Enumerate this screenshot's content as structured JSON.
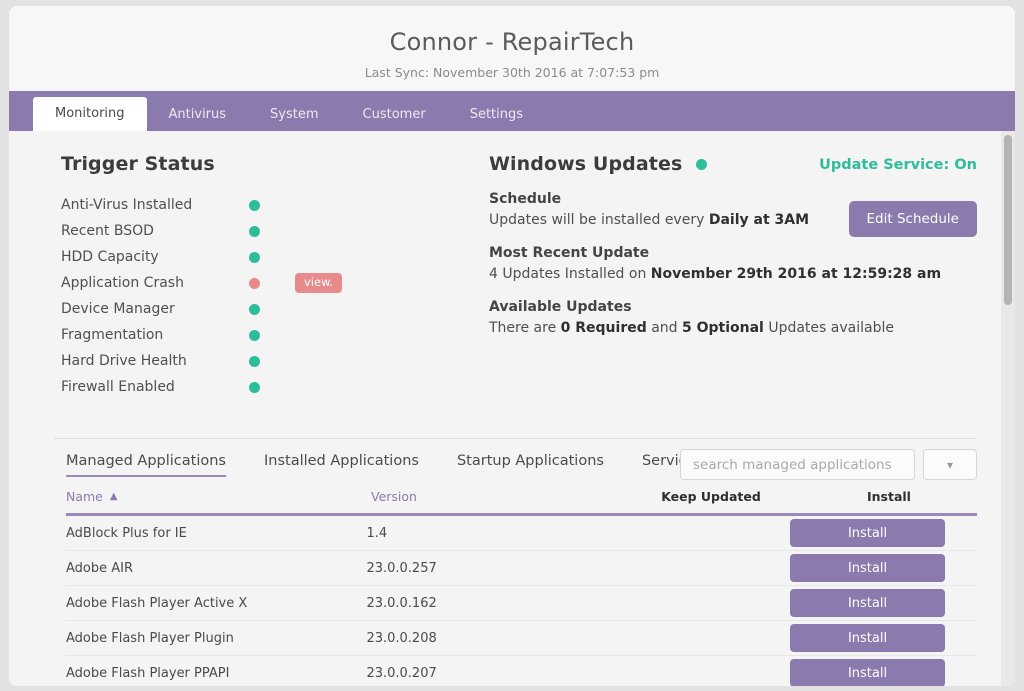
{
  "header": {
    "title": "Connor - RepairTech",
    "last_sync": "Last Sync: November 30th 2016 at 7:07:53 pm"
  },
  "nav": {
    "tabs": [
      {
        "label": "Monitoring",
        "active": true
      },
      {
        "label": "Antivirus",
        "active": false
      },
      {
        "label": "System",
        "active": false
      },
      {
        "label": "Customer",
        "active": false
      },
      {
        "label": "Settings",
        "active": false
      }
    ]
  },
  "trigger_status": {
    "title": "Trigger Status",
    "items": [
      {
        "label": "Anti-Virus Installed",
        "status": "green",
        "action": null
      },
      {
        "label": "Recent BSOD",
        "status": "green",
        "action": null
      },
      {
        "label": "HDD Capacity",
        "status": "green",
        "action": null
      },
      {
        "label": "Application Crash",
        "status": "red",
        "action": "view."
      },
      {
        "label": "Device Manager",
        "status": "green",
        "action": null
      },
      {
        "label": "Fragmentation",
        "status": "green",
        "action": null
      },
      {
        "label": "Hard Drive Health",
        "status": "green",
        "action": null
      },
      {
        "label": "Firewall Enabled",
        "status": "green",
        "action": null
      }
    ]
  },
  "windows_updates": {
    "title": "Windows Updates",
    "status": "green",
    "service_label": "Update Service: On",
    "edit_schedule_label": "Edit Schedule",
    "schedule_heading": "Schedule",
    "schedule_text_prefix": "Updates will be installed every ",
    "schedule_value": "Daily at 3AM",
    "recent_heading": "Most Recent Update",
    "recent_prefix": "4 Updates Installed on ",
    "recent_value": "November 29th 2016 at 12:59:28 am",
    "available_heading": "Available Updates",
    "available_prefix": "There are ",
    "available_required": "0 Required",
    "available_mid": " and ",
    "available_optional": "5 Optional",
    "available_suffix": " Updates available"
  },
  "apps": {
    "tabs": [
      {
        "label": "Managed Applications",
        "active": true
      },
      {
        "label": "Installed Applications",
        "active": false
      },
      {
        "label": "Startup Applications",
        "active": false
      },
      {
        "label": "Services",
        "active": false
      }
    ],
    "search_placeholder": "search managed applications",
    "search_value": "",
    "filter_icon": "chevron-down-icon",
    "columns": {
      "name": "Name",
      "version": "Version",
      "keep_updated": "Keep Updated",
      "install": "Install"
    },
    "sort": {
      "column": "Name",
      "direction": "asc",
      "caret": "▲"
    },
    "install_label": "Install",
    "rows": [
      {
        "name": "AdBlock Plus for IE",
        "version": "1.4",
        "keep_updated": "",
        "install": "Install"
      },
      {
        "name": "Adobe AIR",
        "version": "23.0.0.257",
        "keep_updated": "",
        "install": "Install"
      },
      {
        "name": "Adobe Flash Player Active X",
        "version": "23.0.0.162",
        "keep_updated": "",
        "install": "Install"
      },
      {
        "name": "Adobe Flash Player Plugin",
        "version": "23.0.0.208",
        "keep_updated": "",
        "install": "Install"
      },
      {
        "name": "Adobe Flash Player PPAPI",
        "version": "23.0.0.207",
        "keep_updated": "",
        "install": "Install"
      }
    ]
  },
  "colors": {
    "accent_purple": "#8b7aad",
    "status_green": "#2ebd9b",
    "status_red": "#e68a8c"
  }
}
